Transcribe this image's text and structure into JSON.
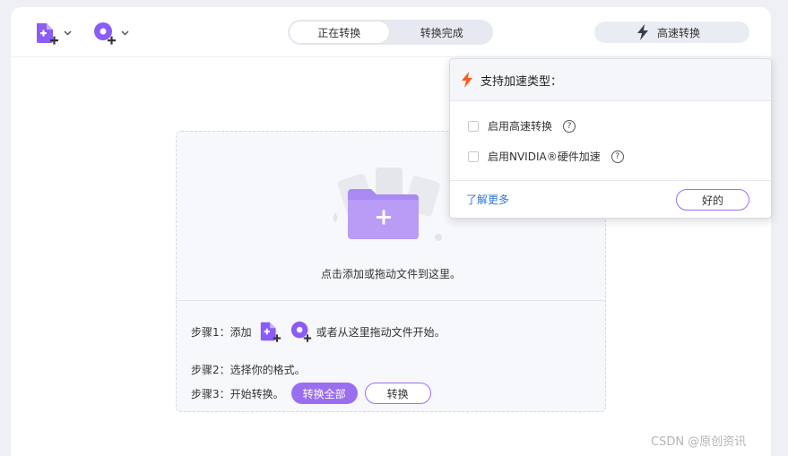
{
  "toolbar": {
    "add_file_icon": "add-file-icon",
    "add_dvd_icon": "add-dvd-icon",
    "dropdown_icon": "chevron-down-icon",
    "tabs": [
      {
        "label": "正在转换",
        "active": true
      },
      {
        "label": "转换完成",
        "active": false
      }
    ],
    "high_speed_label": "高速转换",
    "high_speed_icon": "lightning-icon"
  },
  "dropzone": {
    "hint": "点击添加或拖动文件到这里。",
    "step1_prefix": "步骤1：添加",
    "step1_suffix": "或者从这里拖动文件开始。",
    "step2": "步骤2：选择你的格式。",
    "step3": "步骤3：开始转换。",
    "convert_all_label": "转换全部",
    "convert_label": "转换"
  },
  "popover": {
    "title": "支持加速类型：",
    "options": [
      {
        "label": "启用高速转换",
        "checked": false
      },
      {
        "label": "启用NVIDIA®硬件加速",
        "checked": false
      }
    ],
    "help_symbol": "?",
    "learn_more": "了解更多",
    "ok_label": "好的"
  },
  "watermark": "CSDN @原创资讯",
  "colors": {
    "accent": "#9b6ef0",
    "link": "#2e76d6",
    "lightning": "#ff5a1f",
    "background": "#eef0f5"
  }
}
